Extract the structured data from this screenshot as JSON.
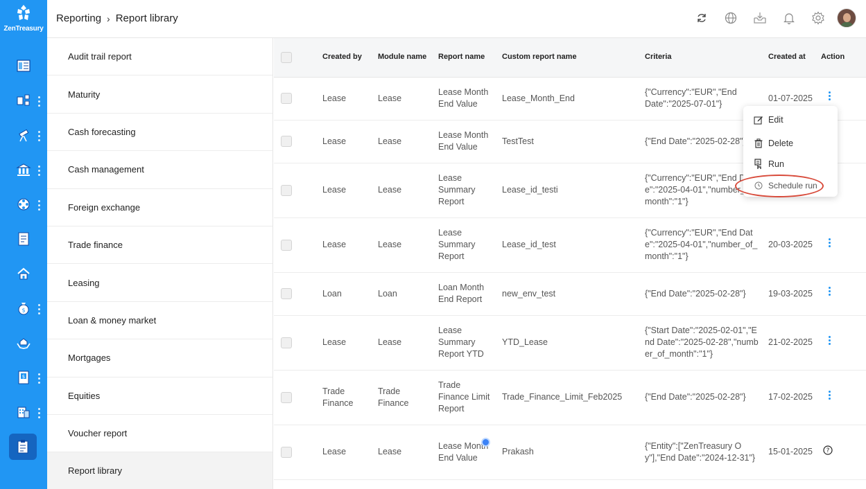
{
  "app": {
    "brand": "ZenTreasury"
  },
  "breadcrumb": {
    "parent": "Reporting",
    "current": "Report library"
  },
  "colors": {
    "rail": "#2196f3",
    "accent": "#2196f3",
    "highlight": "#d84a3a"
  },
  "reports": [
    "Audit trail report",
    "Maturity",
    "Cash forecasting",
    "Cash management",
    "Foreign exchange",
    "Trade finance",
    "Leasing",
    "Loan & money market",
    "Mortgages",
    "Equities",
    "Voucher report",
    "Report library"
  ],
  "table": {
    "headers": {
      "created_by": "Created by",
      "module": "Module name",
      "report": "Report name",
      "custom": "Custom report name",
      "criteria": "Criteria",
      "created_at": "Created at",
      "action": "Action"
    },
    "rows": [
      {
        "created_by": "Lease",
        "module": "Lease",
        "report": "Lease Month End Value",
        "custom": "Lease_Month_End",
        "criteria": "{\"Currency\":\"EUR\",\"End Date\":\"2025-07-01\"}",
        "created_at": "01-07-2025"
      },
      {
        "created_by": "Lease",
        "module": "Lease",
        "report": "Lease Month End Value",
        "custom": "TestTest",
        "criteria": "{\"End Date\":\"2025-02-28\"}",
        "created_at": ""
      },
      {
        "created_by": "Lease",
        "module": "Lease",
        "report": "Lease Summary Report",
        "custom": "Lease_id_testi",
        "criteria": "{\"Currency\":\"EUR\",\"End Date\":\"2025-04-01\",\"number_of_month\":\"1\"}",
        "created_at": ""
      },
      {
        "created_by": "Lease",
        "module": "Lease",
        "report": "Lease Summary Report",
        "custom": "Lease_id_test",
        "criteria": "{\"Currency\":\"EUR\",\"End Date\":\"2025-04-01\",\"number_of_month\":\"1\"}",
        "created_at": "20-03-2025"
      },
      {
        "created_by": "Loan",
        "module": "Loan",
        "report": "Loan Month End Report",
        "custom": "new_env_test",
        "criteria": "{\"End Date\":\"2025-02-28\"}",
        "created_at": "19-03-2025"
      },
      {
        "created_by": "Lease",
        "module": "Lease",
        "report": "Lease Summary Report YTD",
        "custom": "YTD_Lease",
        "criteria": "{\"Start Date\":\"2025-02-01\",\"End Date\":\"2025-02-28\",\"number_of_month\":\"1\"}",
        "created_at": "21-02-2025"
      },
      {
        "created_by": "Trade Finance",
        "module": "Trade Finance",
        "report": "Trade Finance Limit Report",
        "custom": "Trade_Finance_Limit_Feb2025",
        "criteria": "{\"End Date\":\"2025-02-28\"}",
        "created_at": "17-02-2025"
      },
      {
        "created_by": "Lease",
        "module": "Lease",
        "report": "Lease Month End Value",
        "custom": "Prakash",
        "criteria": "{\"Entity\":[\"ZenTreasury Oy\"],\"End Date\":\"2024-12-31\"}",
        "created_at": "15-01-2025"
      }
    ]
  },
  "context_menu": {
    "edit": "Edit",
    "delete": "Delete",
    "run": "Run",
    "schedule": "Schedule run"
  }
}
